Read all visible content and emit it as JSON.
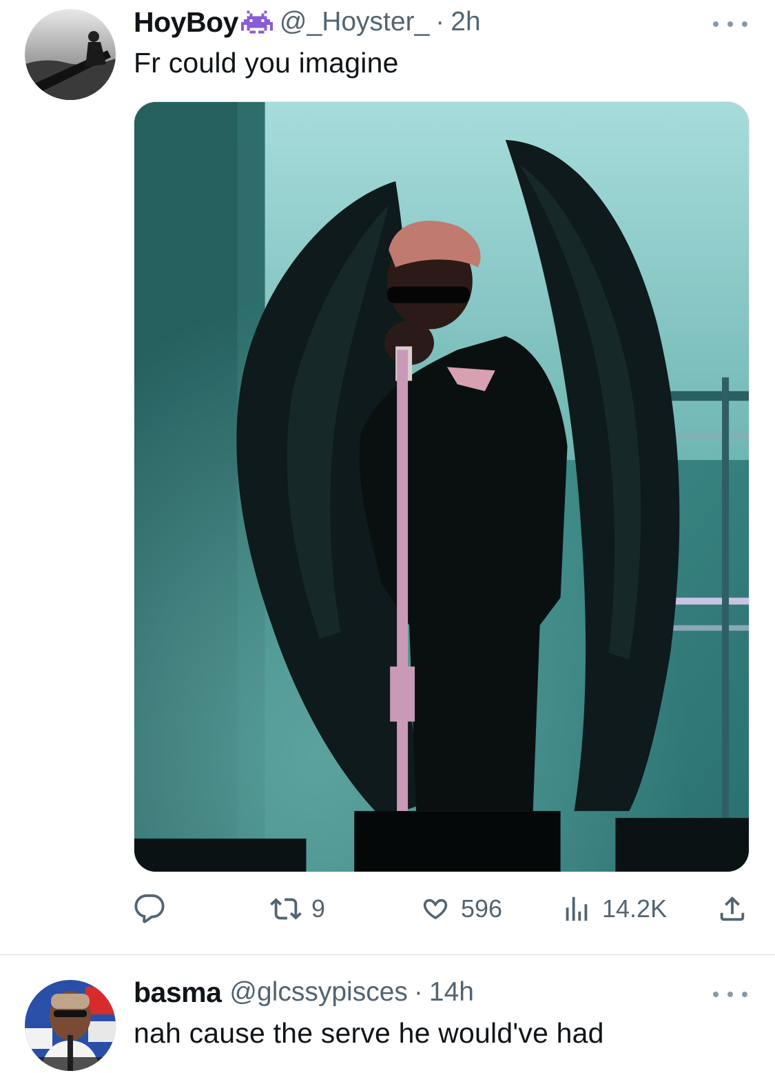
{
  "tweets": [
    {
      "author_name": "HoyBoy",
      "badge_icon": "space-invader-emoji-icon",
      "handle": "@_Hoyster_",
      "separator": "·",
      "time": "2h",
      "text": "Fr could you imagine",
      "media": "photo-performer-black-wings-on-stage",
      "actions": {
        "reply": {
          "icon": "reply-icon",
          "count": ""
        },
        "retweet": {
          "icon": "retweet-icon",
          "count": "9"
        },
        "like": {
          "icon": "heart-icon",
          "count": "596"
        },
        "views": {
          "icon": "analytics-icon",
          "count": "14.2K"
        },
        "share": {
          "icon": "share-icon",
          "count": ""
        }
      }
    },
    {
      "author_name": "basma",
      "handle": "@glcssypisces",
      "separator": "·",
      "time": "14h",
      "text": "nah cause the serve he would've had"
    }
  ],
  "colors": {
    "text_primary": "#0f1419",
    "text_secondary": "#536471",
    "divider": "#d9dde1",
    "badge_purple": "#8a5bd6"
  }
}
